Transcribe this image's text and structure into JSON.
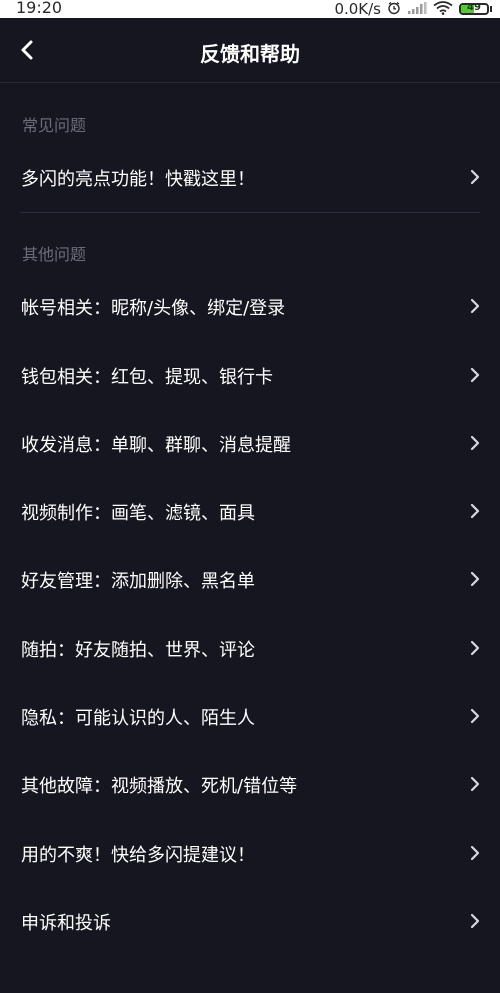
{
  "status_bar": {
    "time": "19:20",
    "net_speed": "0.0K/s",
    "battery_level": "49",
    "icons": [
      "alarm-icon",
      "signal-icon",
      "wifi-icon",
      "battery-icon"
    ]
  },
  "nav": {
    "back_icon": "back-arrow-icon",
    "title": "反馈和帮助"
  },
  "sections": {
    "common": {
      "header": "常见问题",
      "items": [
        {
          "label": "多闪的亮点功能！快戳这里！"
        }
      ]
    },
    "other": {
      "header": "其他问题",
      "items": [
        {
          "label": "帐号相关：昵称/头像、绑定/登录"
        },
        {
          "label": "钱包相关：红包、提现、银行卡"
        },
        {
          "label": "收发消息：单聊、群聊、消息提醒"
        },
        {
          "label": "视频制作：画笔、滤镜、面具"
        },
        {
          "label": "好友管理：添加删除、黑名单"
        },
        {
          "label": "随拍：好友随拍、世界、评论"
        },
        {
          "label": "隐私：可能认识的人、陌生人"
        },
        {
          "label": "其他故障：视频播放、死机/错位等"
        },
        {
          "label": "用的不爽！快给多闪提建议！"
        },
        {
          "label": "申诉和投诉"
        }
      ]
    }
  },
  "colors": {
    "background": "#161620",
    "text_primary": "#ffffff",
    "text_secondary": "#6c6c78",
    "battery_green": "#58c83a"
  }
}
